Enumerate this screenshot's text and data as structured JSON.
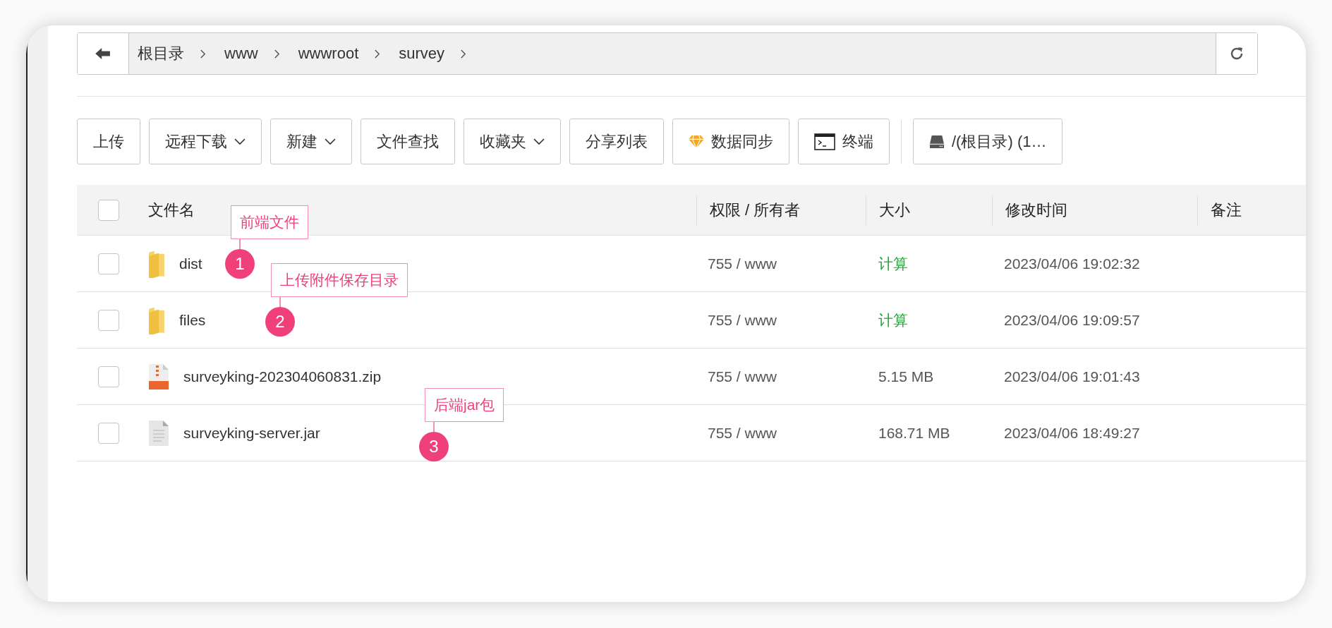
{
  "breadcrumb": {
    "items": [
      "根目录",
      "www",
      "wwwroot",
      "survey"
    ]
  },
  "toolbar": [
    {
      "label": "上传",
      "kind": "plain"
    },
    {
      "label": "远程下载",
      "kind": "dropdown"
    },
    {
      "label": "新建",
      "kind": "dropdown"
    },
    {
      "label": "文件查找",
      "kind": "plain"
    },
    {
      "label": "收藏夹",
      "kind": "dropdown"
    },
    {
      "label": "分享列表",
      "kind": "plain"
    },
    {
      "label": "数据同步",
      "kind": "gem"
    },
    {
      "label": "终端",
      "kind": "terminal"
    },
    {
      "label": "/(根目录) (1…",
      "kind": "drive"
    }
  ],
  "table": {
    "select_all": {
      "checked": false
    },
    "columns": [
      "文件名",
      "权限 / 所有者",
      "大小",
      "修改时间",
      "备注"
    ],
    "rows": [
      {
        "checked": false,
        "kind": "folder",
        "name": "dist",
        "permissions": "755 / www",
        "size": "计算",
        "modified": "2023/04/06 19:02:32"
      },
      {
        "checked": false,
        "kind": "folder",
        "name": "files",
        "permissions": "755 / www",
        "size": "计算",
        "modified": "2023/04/06 19:09:57"
      },
      {
        "checked": false,
        "kind": "zip",
        "name": "surveyking-202304060831.zip",
        "permissions": "755 / www",
        "size": "5.15 MB",
        "modified": "2023/04/06 19:01:43"
      },
      {
        "checked": false,
        "kind": "file",
        "name": "surveyking-server.jar",
        "permissions": "755 / www",
        "size": "168.71 MB",
        "modified": "2023/04/06 18:49:27"
      }
    ]
  },
  "annotations": [
    {
      "number": "1",
      "label": "前端文件"
    },
    {
      "number": "2",
      "label": "上传附件保存目录"
    },
    {
      "number": "3",
      "label": "后端jar包"
    }
  ]
}
